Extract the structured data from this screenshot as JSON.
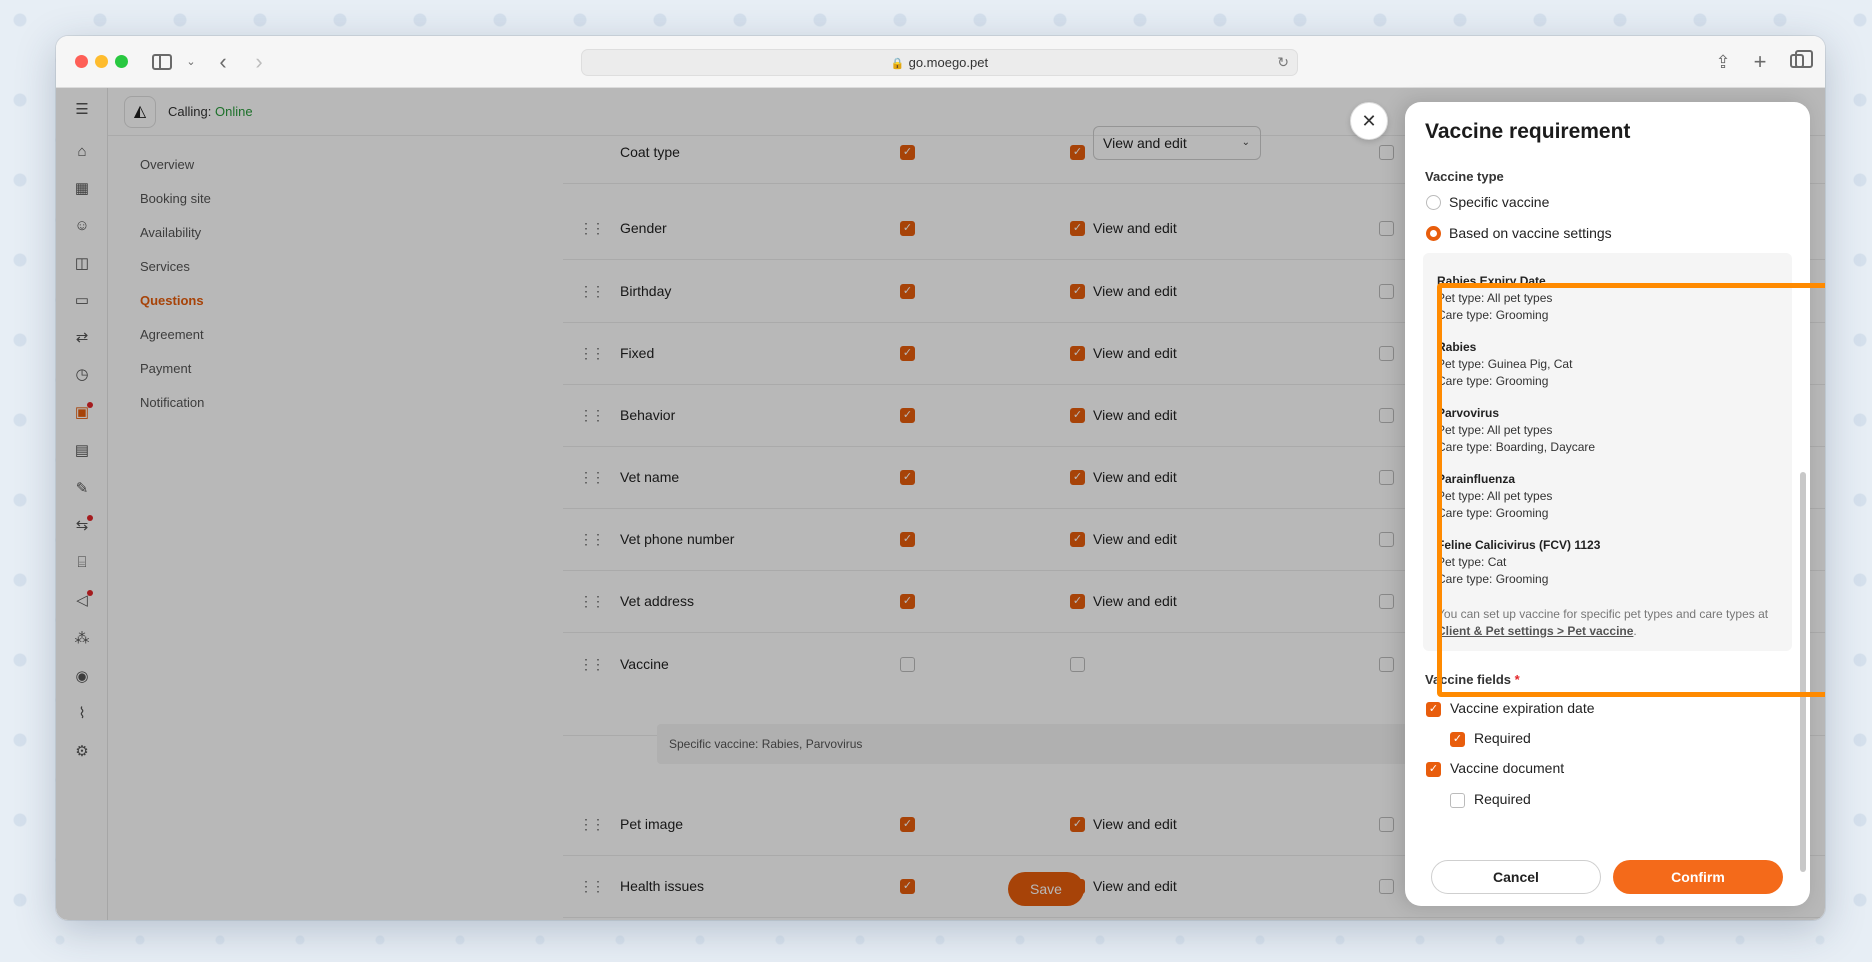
{
  "browser": {
    "url": "go.moego.pet"
  },
  "topbar": {
    "calling_label": "Calling:",
    "calling_status": "Online"
  },
  "settings_nav": [
    {
      "label": "Overview",
      "active": false
    },
    {
      "label": "Booking site",
      "active": false
    },
    {
      "label": "Availability",
      "active": false
    },
    {
      "label": "Services",
      "active": false
    },
    {
      "label": "Questions",
      "active": true
    },
    {
      "label": "Agreement",
      "active": false
    },
    {
      "label": "Payment",
      "active": false
    },
    {
      "label": "Notification",
      "active": false
    }
  ],
  "questions": [
    {
      "name": "Coat type",
      "col1": true,
      "col2": true,
      "permission": "View and edit",
      "permission_select": true,
      "col3": false
    },
    {
      "name": "Gender",
      "col1": true,
      "col2": true,
      "permission": "View and edit",
      "col3": false
    },
    {
      "name": "Birthday",
      "col1": true,
      "col2": true,
      "permission": "View and edit",
      "col3": false
    },
    {
      "name": "Fixed",
      "col1": true,
      "col2": true,
      "permission": "View and edit",
      "col3": false
    },
    {
      "name": "Behavior",
      "col1": true,
      "col2": true,
      "permission": "View and edit",
      "col3": false
    },
    {
      "name": "Vet name",
      "col1": true,
      "col2": true,
      "permission": "View and edit",
      "col3": false
    },
    {
      "name": "Vet phone number",
      "col1": true,
      "col2": true,
      "permission": "View and edit",
      "col3": false
    },
    {
      "name": "Vet address",
      "col1": true,
      "col2": true,
      "permission": "View and edit",
      "col3": false
    },
    {
      "name": "Vaccine",
      "col1": false,
      "col2": false,
      "permission": "",
      "col3": false
    },
    {
      "name": "Pet image",
      "col1": true,
      "col2": true,
      "permission": "View and edit",
      "col3": false
    },
    {
      "name": "Health issues",
      "col1": true,
      "col2": true,
      "permission": "View and edit",
      "col3": false
    }
  ],
  "vaccine_subrow": "Specific vaccine: Rabies, Parvovirus",
  "save_label": "Save",
  "drawer": {
    "title": "Vaccine requirement",
    "vaccine_type_label": "Vaccine type",
    "option_specific": "Specific vaccine",
    "option_settings": "Based on vaccine settings",
    "selected_option": "settings",
    "vaccines": [
      {
        "name": "Rabies Expiry Date",
        "pet_type": "Pet type: All pet types",
        "care_type": "Care type: Grooming"
      },
      {
        "name": "Rabies",
        "pet_type": "Pet type: Guinea Pig, Cat",
        "care_type": "Care type: Grooming"
      },
      {
        "name": "Parvovirus",
        "pet_type": "Pet type: All pet types",
        "care_type": "Care type: Boarding, Daycare"
      },
      {
        "name": "Parainfluenza",
        "pet_type": "Pet type: All pet types",
        "care_type": "Care type: Grooming"
      },
      {
        "name": "Feline Calicivirus (FCV) 1123",
        "pet_type": "Pet type: Cat",
        "care_type": "Care type: Grooming"
      }
    ],
    "note_text": "You can set up vaccine for specific pet types and care types at ",
    "note_link": "Client & Pet settings > Pet vaccine",
    "note_end": ".",
    "fields_label": "Vaccine fields",
    "required_star": "*",
    "fields": [
      {
        "label": "Vaccine expiration date",
        "checked": true,
        "indent": false
      },
      {
        "label": "Required",
        "checked": true,
        "indent": true
      },
      {
        "label": "Vaccine document",
        "checked": true,
        "indent": false
      },
      {
        "label": "Required",
        "checked": false,
        "indent": true
      }
    ],
    "cancel_label": "Cancel",
    "confirm_label": "Confirm"
  },
  "colors": {
    "accent": "#e85d0c",
    "highlight": "#ff8a00",
    "online": "#2a9d3c"
  }
}
